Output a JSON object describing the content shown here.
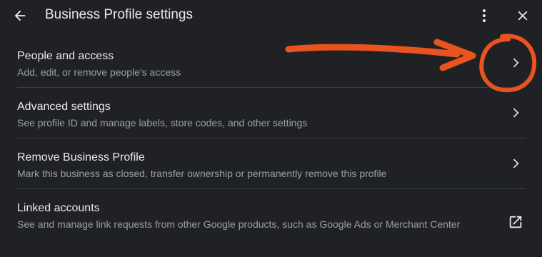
{
  "header": {
    "title": "Business Profile settings",
    "back_icon": "arrow-back-icon",
    "more_icon": "more-vert-icon",
    "close_icon": "close-icon"
  },
  "rows": [
    {
      "title": "People and access",
      "subtitle": "Add, edit, or remove people's access",
      "icon": "chevron-right-icon"
    },
    {
      "title": "Advanced settings",
      "subtitle": "See profile ID and manage labels, store codes, and other settings",
      "icon": "chevron-right-icon"
    },
    {
      "title": "Remove Business Profile",
      "subtitle": "Mark this business as closed, transfer ownership or permanently remove this profile",
      "icon": "chevron-right-icon"
    },
    {
      "title": "Linked accounts",
      "subtitle": "See and manage link requests from other Google products, such as Google Ads or Merchant Center",
      "icon": "open-in-new-icon"
    }
  ],
  "colors": {
    "background": "#202124",
    "text_primary": "#e8eaed",
    "text_secondary": "#9aa0a6",
    "divider": "#3c4043",
    "annotation": "#e8531f"
  }
}
